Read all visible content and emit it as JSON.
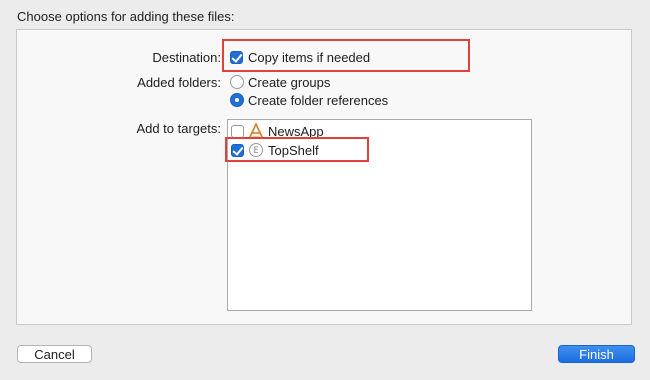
{
  "dialog": {
    "title": "Choose options for adding these files:"
  },
  "destination": {
    "label": "Destination:",
    "copy_items_label": "Copy items if needed",
    "copy_items_checked": true
  },
  "added_folders": {
    "label": "Added folders:",
    "options": [
      {
        "label": "Create groups",
        "selected": false
      },
      {
        "label": "Create folder references",
        "selected": true
      }
    ]
  },
  "targets": {
    "label": "Add to targets:",
    "items": [
      {
        "name": "NewsApp",
        "checked": false,
        "icon": "app-target-icon"
      },
      {
        "name": "TopShelf",
        "checked": true,
        "icon": "extension-target-icon"
      }
    ]
  },
  "buttons": {
    "cancel": "Cancel",
    "finish": "Finish"
  },
  "colors": {
    "accent": "#1f6fd6",
    "highlight": "#e0413c"
  }
}
